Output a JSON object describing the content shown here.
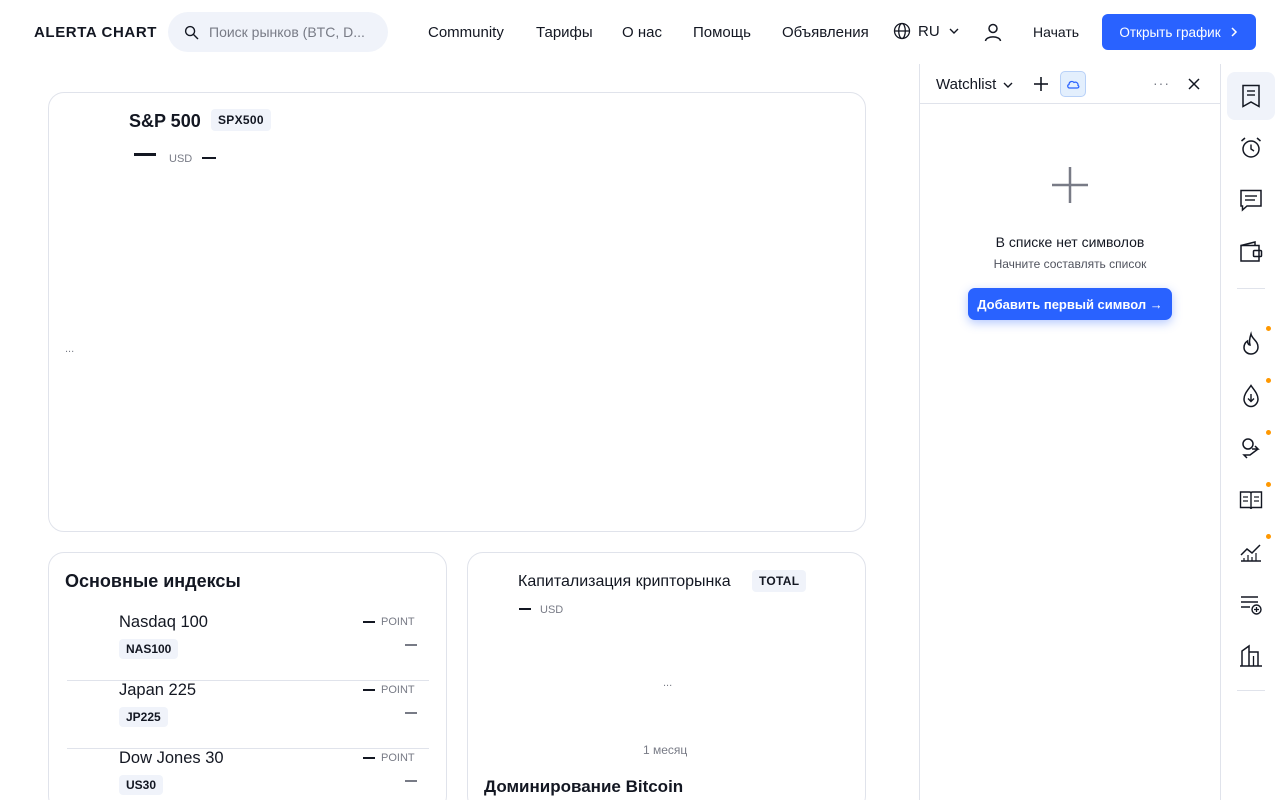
{
  "header": {
    "logo": "ALERTA CHART",
    "search_placeholder": "Поиск рынков (BTC, D...",
    "nav": [
      "Community",
      "Тарифы",
      "О нас",
      "Помощь",
      "Объявления"
    ],
    "language": "RU",
    "start_label": "Начать",
    "open_chart_label": "Открыть график"
  },
  "main_chart": {
    "name": "S&P 500",
    "ticker": "SPX500",
    "currency": "USD",
    "loading": "..."
  },
  "indices": {
    "title": "Основные индексы",
    "rows": [
      {
        "name": "Nasdaq 100",
        "ticker": "NAS100",
        "unit": "POINT"
      },
      {
        "name": "Japan 225",
        "ticker": "JP225",
        "unit": "POINT"
      },
      {
        "name": "Dow Jones 30",
        "ticker": "US30",
        "unit": "POINT"
      }
    ]
  },
  "crypto_cap": {
    "name": "Капитализация крипторынка",
    "ticker": "TOTAL",
    "currency": "USD",
    "loading": "...",
    "period": "1 месяц",
    "dominance_title": "Доминирование Bitcoin"
  },
  "watchlist": {
    "title": "Watchlist",
    "more": "···",
    "empty_title": "В списке нет символов",
    "empty_hint": "Начните составлять список",
    "add_button": "Добавить первый символ →"
  },
  "toolbar": {
    "icons": [
      "watchlist-icon",
      "alarm-clock-icon",
      "chat-icon",
      "wallet-icon",
      "flame-icon",
      "drop-down-icon",
      "exchange-icon",
      "news-icon",
      "chart-line-icon",
      "list-add-icon",
      "buildings-icon"
    ]
  },
  "colors": {
    "accent": "#2962ff",
    "notification_dot": "#ff9800",
    "border": "#e0e3eb"
  }
}
